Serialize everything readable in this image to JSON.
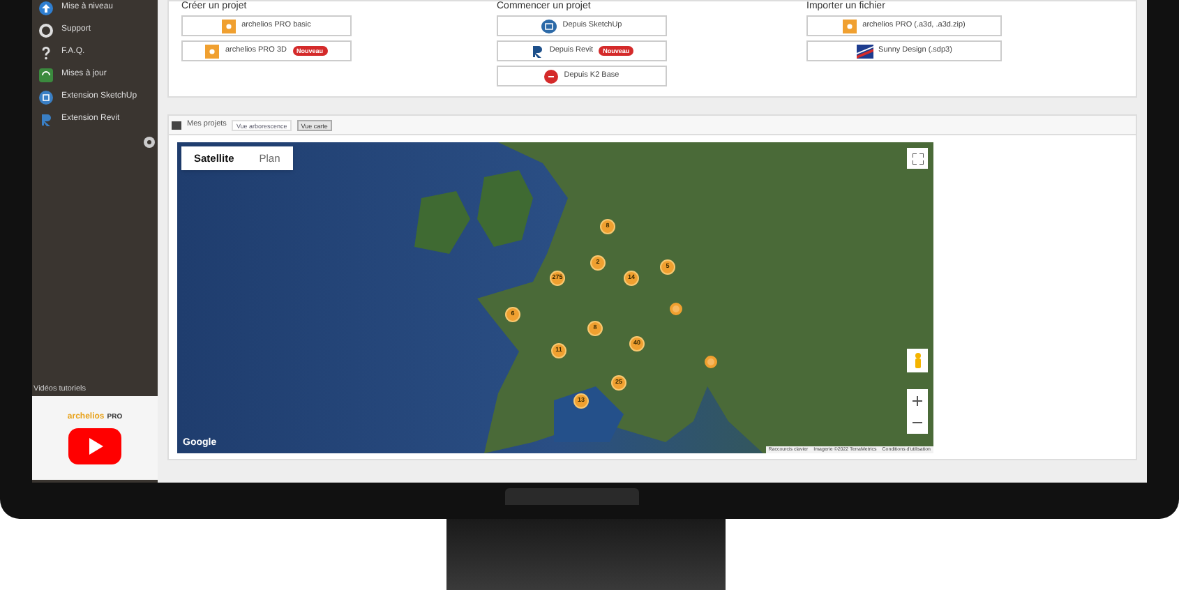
{
  "sidebar": {
    "items": [
      {
        "label": "Mise à niveau",
        "kind": "upgrade"
      },
      {
        "label": "Support",
        "kind": "support"
      },
      {
        "label": "F.A.Q.",
        "kind": "faq"
      },
      {
        "label": "Mises à jour",
        "kind": "updates"
      },
      {
        "label": "Extension SketchUp",
        "kind": "sketchup"
      },
      {
        "label": "Extension Revit",
        "kind": "revit"
      }
    ],
    "videos": {
      "title": "Vidéos tutoriels",
      "brand": "archelios",
      "brand_suffix": "PRO"
    }
  },
  "actions": [
    {
      "heading": "Créer un projet",
      "buttons": [
        {
          "label": "archelios PRO basic",
          "kind": "archelios"
        },
        {
          "label": "archelios PRO 3D",
          "kind": "archelios",
          "badge": "Nouveau"
        }
      ]
    },
    {
      "heading": "Commencer un projet",
      "buttons": [
        {
          "label": "Depuis SketchUp",
          "kind": "sketchup"
        },
        {
          "label": "Depuis Revit",
          "kind": "revit",
          "badge": "Nouveau"
        },
        {
          "label": "Depuis K2 Base",
          "kind": "k2"
        }
      ]
    },
    {
      "heading": "Importer un fichier",
      "buttons": [
        {
          "label": "archelios PRO (.a3d, .a3d.zip)",
          "kind": "archelios"
        },
        {
          "label": "Sunny Design (.sdp3)",
          "kind": "sunny"
        }
      ]
    }
  ],
  "projects": {
    "title": "Mes projets",
    "tabs": [
      {
        "label": "Vue arborescence",
        "selected": false
      },
      {
        "label": "Vue carte",
        "selected": true
      }
    ],
    "map": {
      "map_types": [
        {
          "label": "Satellite",
          "selected": true
        },
        {
          "label": "Plan",
          "selected": false
        }
      ],
      "clusters": [
        {
          "kind": "count",
          "label": "8"
        },
        {
          "kind": "count",
          "label": "2"
        },
        {
          "kind": "count",
          "label": "275"
        },
        {
          "kind": "count",
          "label": "14"
        },
        {
          "kind": "count",
          "label": "5"
        },
        {
          "kind": "pin"
        },
        {
          "kind": "count",
          "label": "6"
        },
        {
          "kind": "count",
          "label": "8"
        },
        {
          "kind": "count",
          "label": "11"
        },
        {
          "kind": "count",
          "label": "40"
        },
        {
          "kind": "count",
          "label": "25"
        },
        {
          "kind": "count",
          "label": "13"
        },
        {
          "kind": "pin"
        }
      ],
      "logo": "Google",
      "attribution": [
        "Raccourcis clavier",
        "Imagerie ©2022 TerraMetrics",
        "Conditions d'utilisation"
      ]
    }
  }
}
